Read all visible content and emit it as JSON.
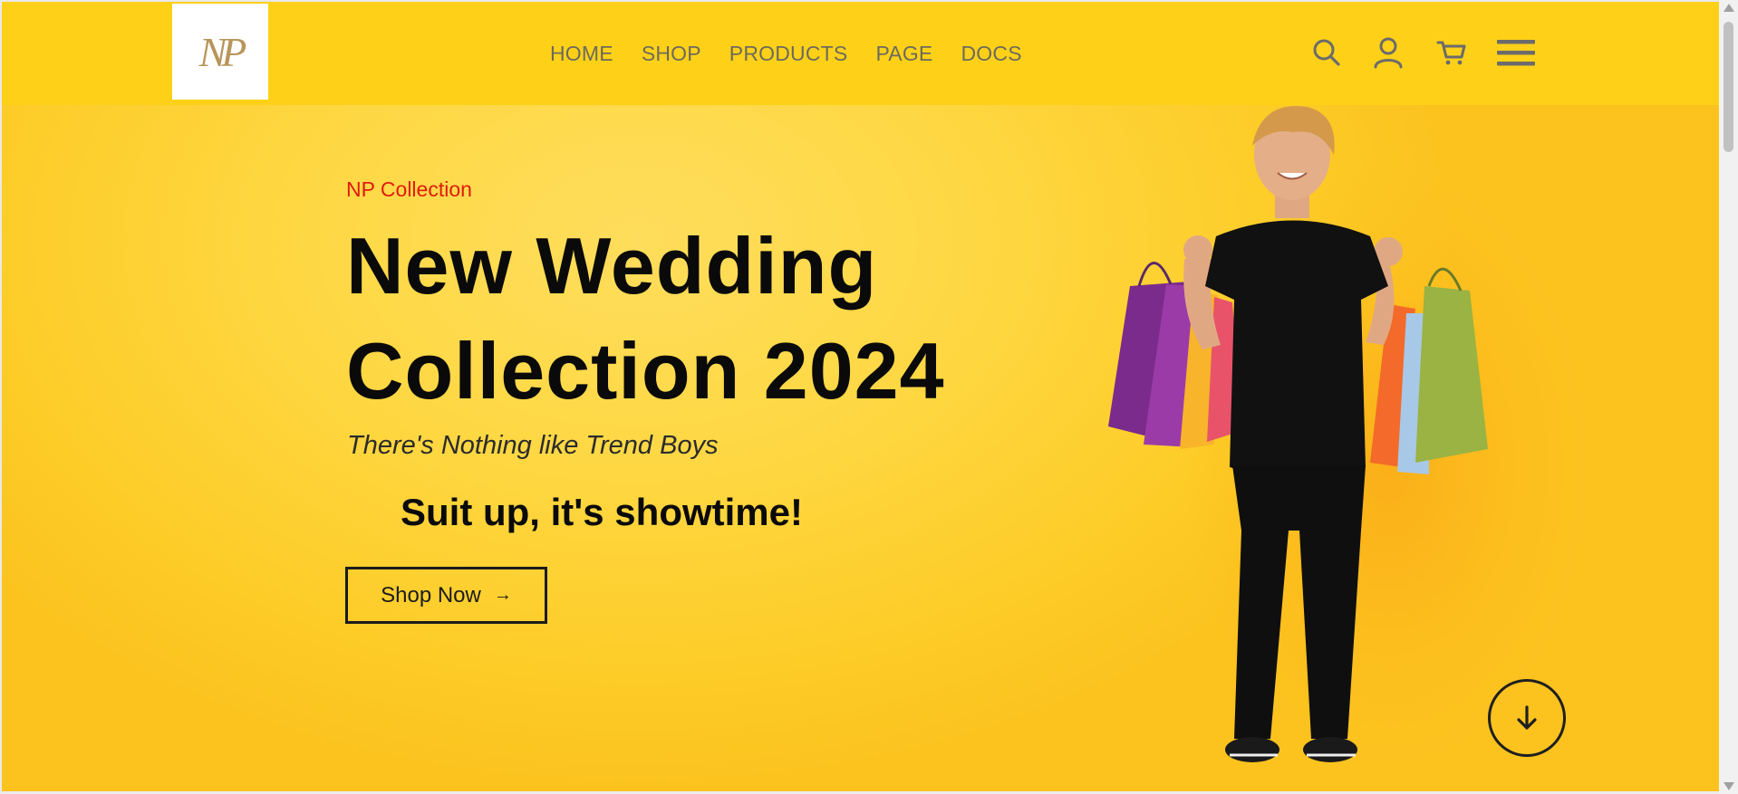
{
  "header": {
    "logo_text": "NP",
    "nav": [
      "HOME",
      "SHOP",
      "PRODUCTS",
      "PAGE",
      "DOCS"
    ],
    "icons": [
      "search-icon",
      "user-icon",
      "cart-icon",
      "menu-icon"
    ]
  },
  "hero": {
    "eyebrow": "NP Collection",
    "headline_line1": "New Wedding",
    "headline_line2": "Collection 2024",
    "tagline": "There's Nothing like Trend Boys",
    "slogan": "Suit up, it's showtime!",
    "cta_label": "Shop Now",
    "cta_arrow": "→"
  },
  "colors": {
    "header_bg": "#fed118",
    "hero_bg": "#fed844",
    "eyebrow": "#e01b0c",
    "nav_text": "#6e6a5c",
    "logo": "#b8955a"
  }
}
